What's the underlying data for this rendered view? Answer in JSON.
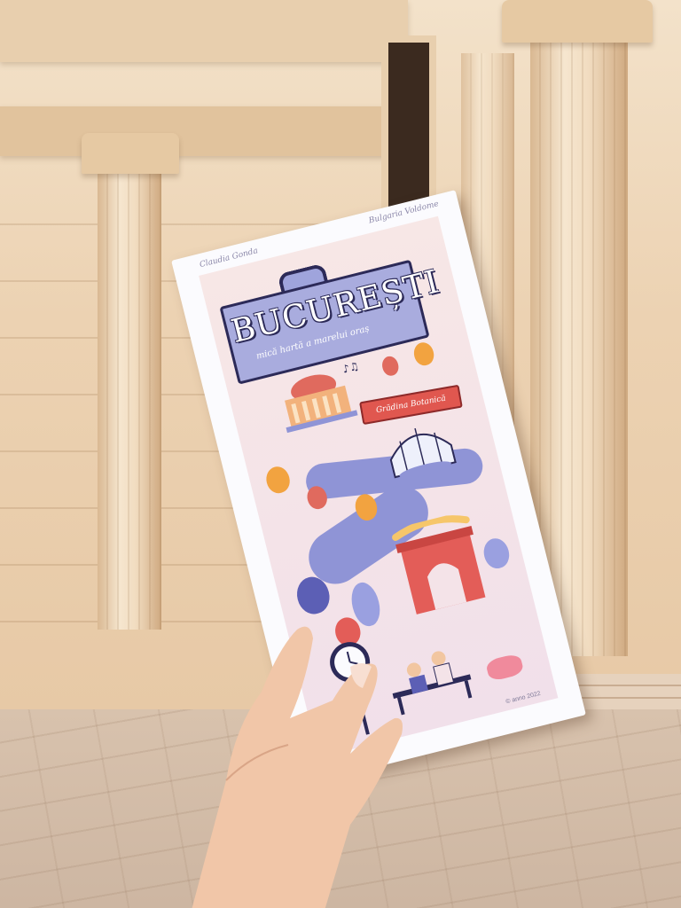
{
  "scene": {
    "colors": {
      "wall": "#ecd2b2",
      "ground": "#d3bca8",
      "brochure_paper": "#fbfbfe",
      "sign_fill": "#a9acde",
      "ink": "#2c2a58",
      "banner_red": "#e0574f"
    }
  },
  "brochure": {
    "author_left": "Claudia Gonda",
    "author_right": "Bulgaria Voldome",
    "title": "BUCUREȘTI",
    "subtitle": "mică hartă a marelui oraș",
    "garden_label": "Grădina Botanică",
    "copyright": "© anno 2022"
  }
}
